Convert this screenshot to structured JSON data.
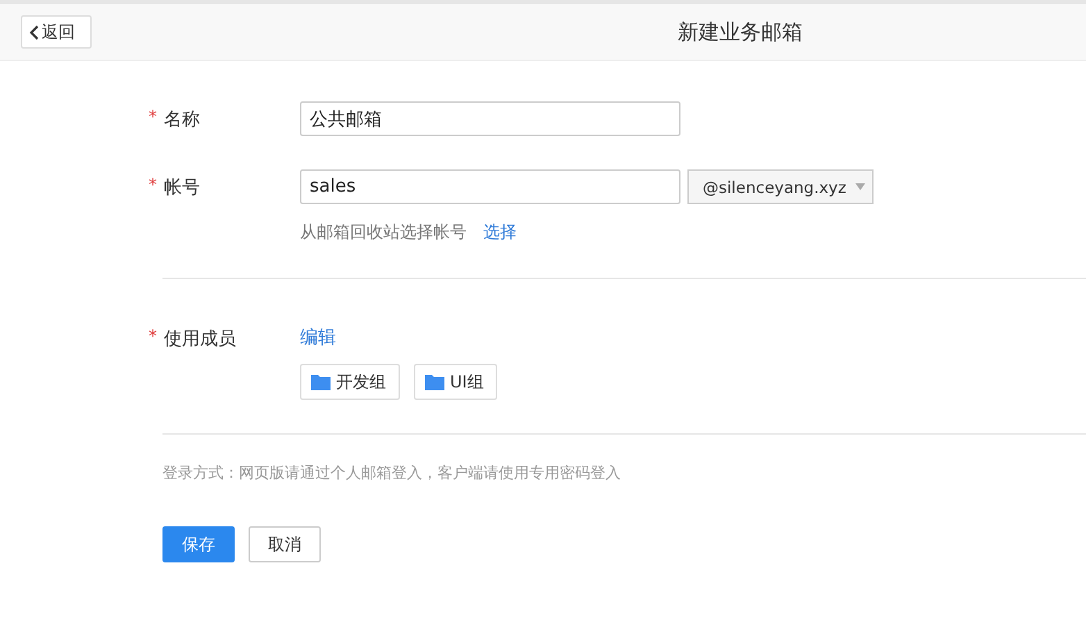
{
  "header": {
    "back_button": "返回",
    "title": "新建业务邮箱"
  },
  "fields": [
    {
      "required_mark": "*",
      "label": "名称",
      "value": "公共邮箱"
    },
    {
      "required_mark": "*",
      "label": "帐号",
      "value": "sales",
      "domain": "@silenceyang.xyz",
      "hint": "从邮箱回收站选择帐号",
      "hint_link": "选择"
    }
  ],
  "members": {
    "required_mark": "*",
    "label": "使用成员",
    "edit_link": "编辑",
    "groups": [
      "开发组",
      "UI组"
    ]
  },
  "login_note": "登录方式：网页版请通过个人邮箱登入，客户端请使用专用密码登入",
  "buttons": {
    "save": "保存",
    "cancel": "取消"
  }
}
